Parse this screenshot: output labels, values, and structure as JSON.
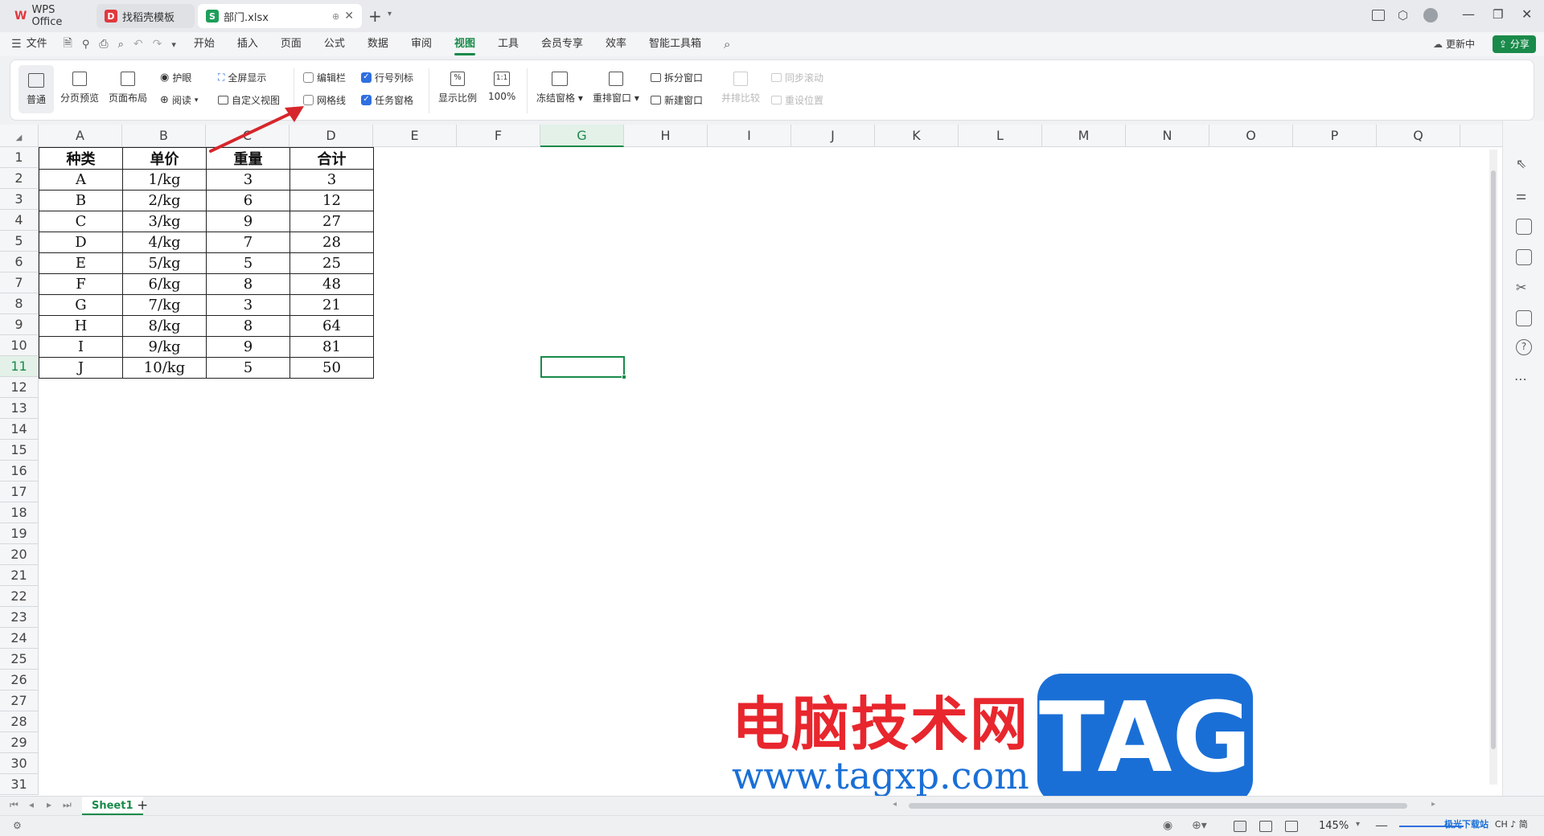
{
  "tabs": [
    {
      "label": "WPS Office",
      "logo": "W"
    },
    {
      "label": "找稻壳模板",
      "logo": "D"
    },
    {
      "label": "部门.xlsx",
      "logo": "S"
    }
  ],
  "menu": {
    "file": "文件",
    "items": [
      "开始",
      "插入",
      "页面",
      "公式",
      "数据",
      "审阅",
      "视图",
      "工具",
      "会员专享",
      "效率",
      "智能工具箱"
    ],
    "update": "更新中",
    "share": "分享"
  },
  "ribbon": {
    "normal": "普通",
    "page_break": "分页预览",
    "page_layout": "页面布局",
    "eye": "护眼",
    "read": "阅读",
    "fullscreen": "全屏显示",
    "custom_view": "自定义视图",
    "edit_bar": "编辑栏",
    "gridlines": "网格线",
    "row_col_header": "行号列标",
    "task_pane": "任务窗格",
    "zoom": "显示比例",
    "zoom100": "100%",
    "zoom100_icon": "1:1",
    "freeze": "冻结窗格",
    "rearrange": "重排窗口",
    "split": "拆分窗口",
    "new_window": "新建窗口",
    "side_by_side": "并排比较",
    "sync_scroll": "同步滚动",
    "reset_pos": "重设位置"
  },
  "checks": {
    "edit_bar": false,
    "gridlines": false,
    "row_col_header": true,
    "task_pane": true
  },
  "columns": [
    "A",
    "B",
    "C",
    "D",
    "E",
    "F",
    "G",
    "H",
    "I",
    "J",
    "K",
    "L",
    "M",
    "N",
    "O",
    "P",
    "Q"
  ],
  "rows": [
    "1",
    "2",
    "3",
    "4",
    "5",
    "6",
    "7",
    "8",
    "9",
    "10",
    "11",
    "12",
    "13",
    "14",
    "15",
    "16",
    "17",
    "18",
    "19",
    "20",
    "21",
    "22",
    "23",
    "24",
    "25",
    "26",
    "27",
    "28",
    "29",
    "30",
    "31"
  ],
  "table": {
    "header": [
      "种类",
      "单价",
      "重量",
      "合计"
    ],
    "rows": [
      [
        "A",
        "1/kg",
        "3",
        "3"
      ],
      [
        "B",
        "2/kg",
        "6",
        "12"
      ],
      [
        "C",
        "3/kg",
        "9",
        "27"
      ],
      [
        "D",
        "4/kg",
        "7",
        "28"
      ],
      [
        "E",
        "5/kg",
        "5",
        "25"
      ],
      [
        "F",
        "6/kg",
        "8",
        "48"
      ],
      [
        "G",
        "7/kg",
        "3",
        "21"
      ],
      [
        "H",
        "8/kg",
        "8",
        "64"
      ],
      [
        "I",
        "9/kg",
        "9",
        "81"
      ],
      [
        "J",
        "10/kg",
        "5",
        "50"
      ]
    ]
  },
  "sheet": {
    "name": "Sheet1"
  },
  "status": {
    "zoom": "145%"
  },
  "watermark": {
    "title": "电脑技术网",
    "url": "www.tagxp.com",
    "tag": "TAG",
    "corner": "极光下载站",
    "lang": "CH ♪ 简"
  },
  "colors": {
    "accent": "#1a8a4a",
    "excel_green": "#1e9e5a",
    "wps_red": "#e0393e",
    "arrow": "#d6262b",
    "watermark_red": "#e8262d",
    "watermark_blue": "#1a6fd6"
  }
}
